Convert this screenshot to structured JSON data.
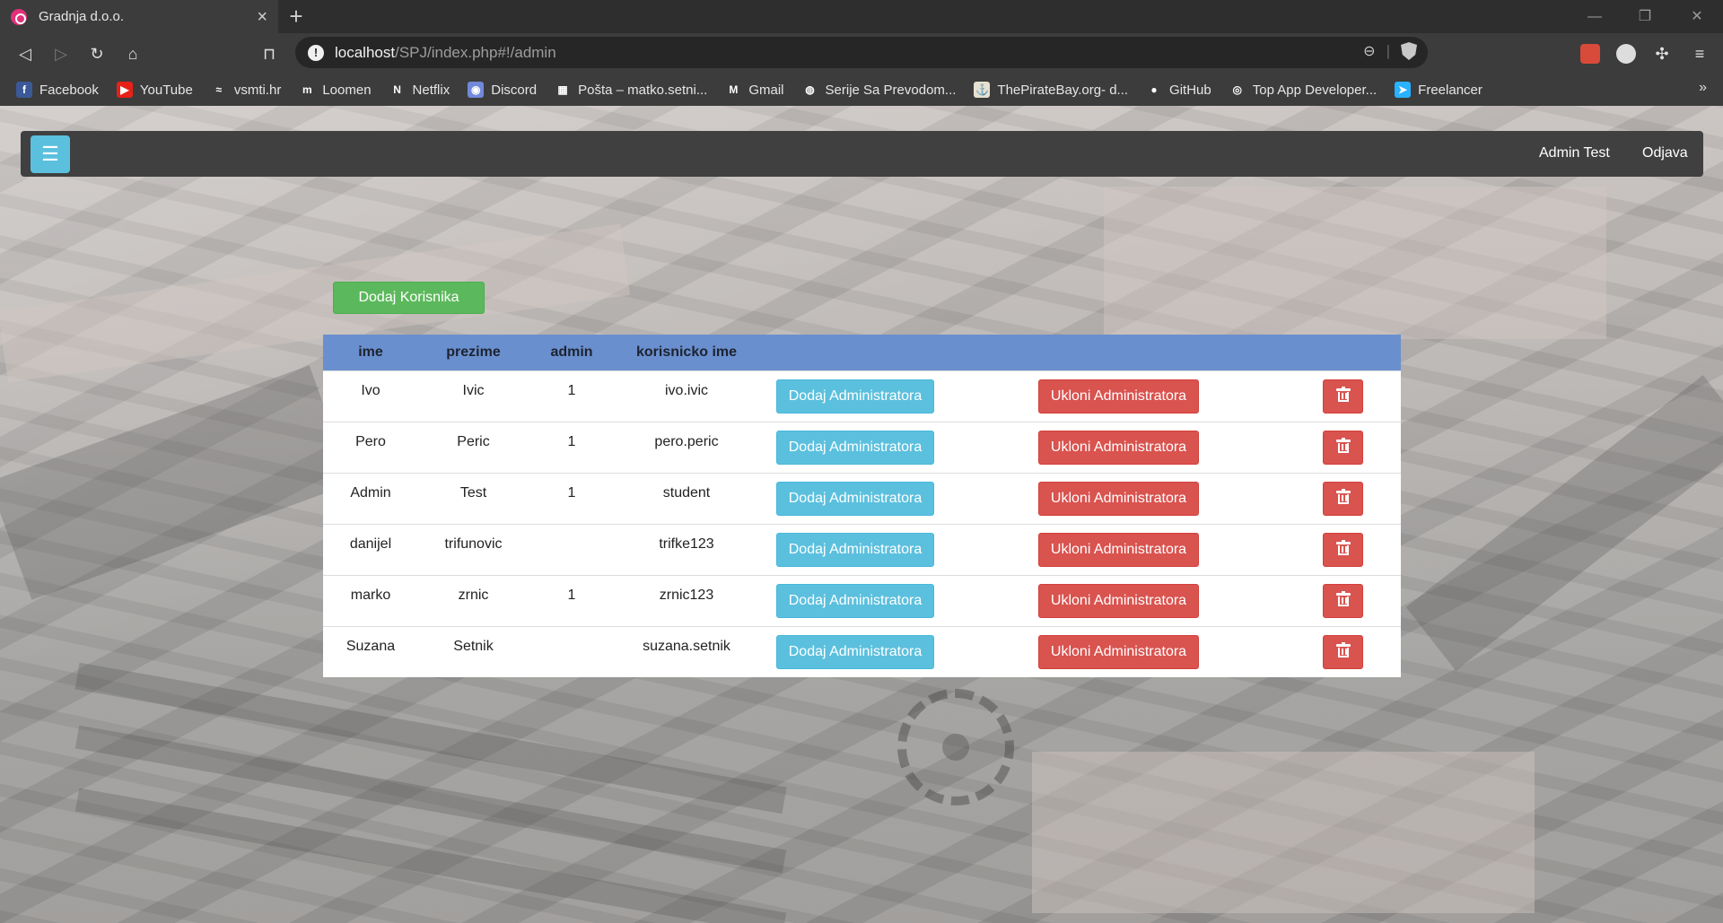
{
  "browser": {
    "tab_title": "Gradnja d.o.o.",
    "tab_close": "×",
    "new_tab": "+",
    "url_host": "localhost",
    "url_path": "/SPJ/index.php#!/admin",
    "bookmarks": [
      {
        "label": "Facebook",
        "icon": "facebook-icon",
        "color": "#3b5998",
        "glyph": "f"
      },
      {
        "label": "YouTube",
        "icon": "youtube-icon",
        "color": "#e62117",
        "glyph": "▶"
      },
      {
        "label": "vsmti.hr",
        "icon": "vsmti-icon",
        "color": "#3c3c3c",
        "glyph": "≈"
      },
      {
        "label": "Loomen",
        "icon": "loomen-icon",
        "color": "#3c3c3c",
        "glyph": "m"
      },
      {
        "label": "Netflix",
        "icon": "netflix-icon",
        "color": "#3c3c3c",
        "glyph": "N"
      },
      {
        "label": "Discord",
        "icon": "discord-icon",
        "color": "#7289da",
        "glyph": "◉"
      },
      {
        "label": "Pošta – matko.setni...",
        "icon": "microsoft-icon",
        "color": "#3c3c3c",
        "glyph": "▦"
      },
      {
        "label": "Gmail",
        "icon": "gmail-icon",
        "color": "#3c3c3c",
        "glyph": "M"
      },
      {
        "label": "Serije Sa Prevodom...",
        "icon": "globe-icon",
        "color": "#3c3c3c",
        "glyph": "◍"
      },
      {
        "label": "ThePirateBay.org- d...",
        "icon": "piratebay-icon",
        "color": "#e8e0d0",
        "glyph": "⚓"
      },
      {
        "label": "GitHub",
        "icon": "github-icon",
        "color": "#3c3c3c",
        "glyph": "●"
      },
      {
        "label": "Top App Developer...",
        "icon": "topapp-icon",
        "color": "#3c3c3c",
        "glyph": "◎"
      },
      {
        "label": "Freelancer",
        "icon": "freelancer-icon",
        "color": "#29b2fe",
        "glyph": "➤"
      }
    ],
    "bookmarks_more": "»"
  },
  "navbar": {
    "menu_glyph": "☰",
    "user_name": "Admin Test",
    "logout": "Odjava"
  },
  "page": {
    "add_user_label": "Dodaj Korisnika",
    "columns": [
      "ime",
      "prezime",
      "admin",
      "korisnicko ime"
    ],
    "add_admin_label": "Dodaj Administratora",
    "remove_admin_label": "Ukloni Administratora",
    "rows": [
      {
        "ime": "Ivo",
        "prezime": "Ivic",
        "admin": "1",
        "korisnicko_ime": "ivo.ivic"
      },
      {
        "ime": "Pero",
        "prezime": "Peric",
        "admin": "1",
        "korisnicko_ime": "pero.peric"
      },
      {
        "ime": "Admin",
        "prezime": "Test",
        "admin": "1",
        "korisnicko_ime": "student"
      },
      {
        "ime": "danijel",
        "prezime": "trifunovic",
        "admin": "",
        "korisnicko_ime": "trifke123"
      },
      {
        "ime": "marko",
        "prezime": "zrnic",
        "admin": "1",
        "korisnicko_ime": "zrnic123"
      },
      {
        "ime": "Suzana",
        "prezime": "Setnik",
        "admin": "",
        "korisnicko_ime": "suzana.setnik"
      }
    ]
  },
  "colors": {
    "navbar_bg": "#404040",
    "menu_button": "#5bc0de",
    "add_user_button": "#5cb85c",
    "table_header": "#6a8fce",
    "add_admin_button": "#5bc0de",
    "remove_admin_button": "#d9534f"
  }
}
